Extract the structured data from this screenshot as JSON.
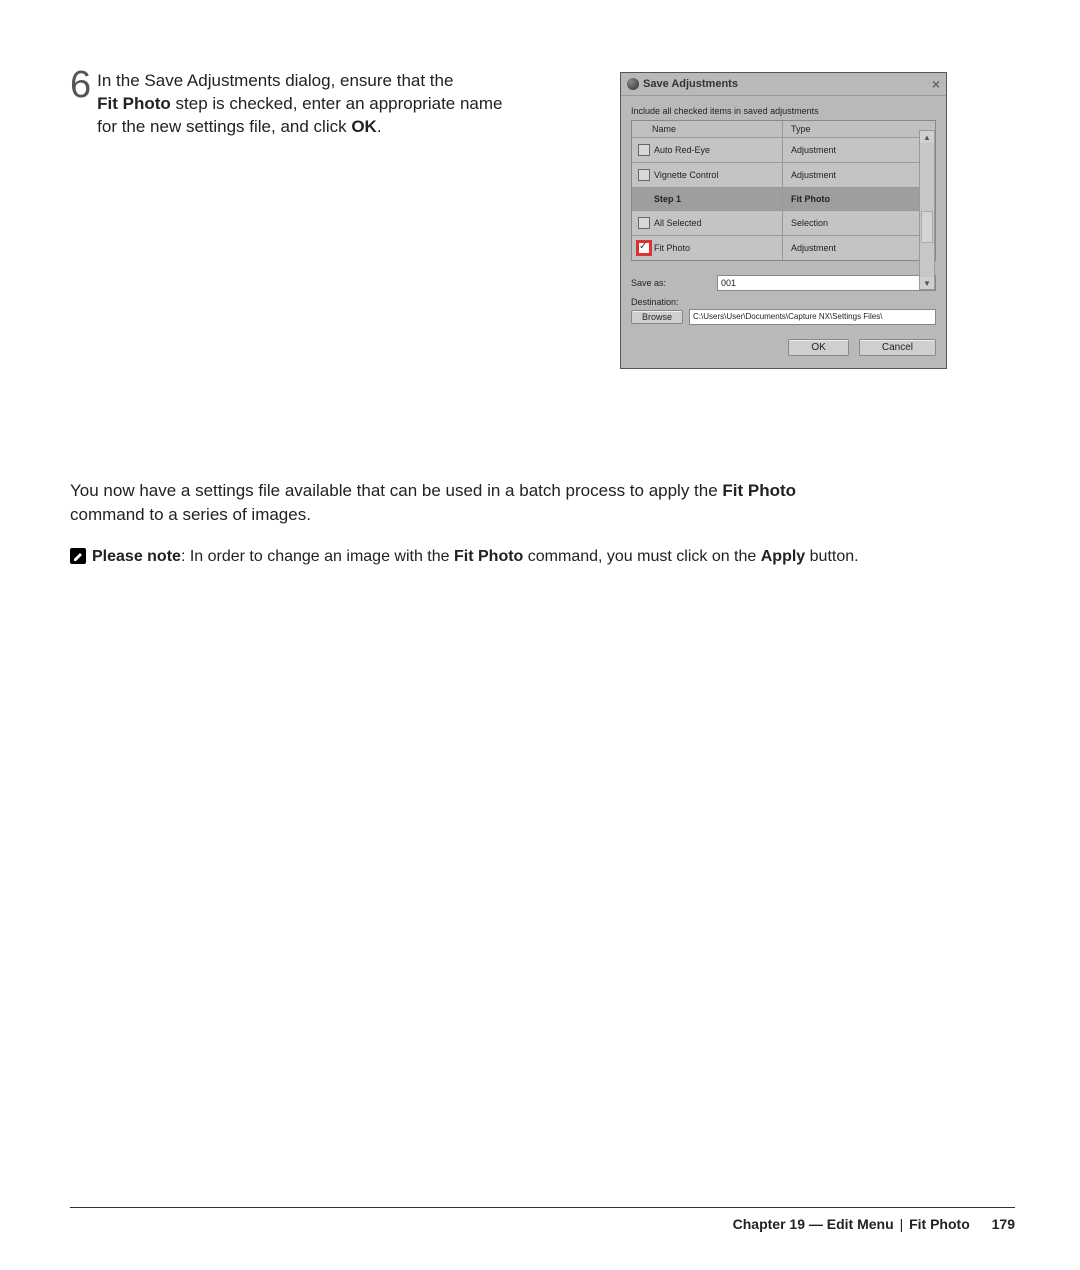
{
  "step": {
    "number": "6",
    "text_pre": "In the  Save Adjustments  dialog, ensure that the ",
    "bold1": "Fit Photo",
    "text_mid": " step is checked, enter an appropriate name for the new settings file, and click ",
    "bold2": "OK",
    "text_end": "."
  },
  "dialog": {
    "title": "Save Adjustments",
    "hint": "Include all checked items in saved adjustments",
    "col_name": "Name",
    "col_type": "Type",
    "rows": [
      {
        "name": "Auto Red-Eye",
        "type": "Adjustment",
        "checked": false,
        "dark": false
      },
      {
        "name": "Vignette Control",
        "type": "Adjustment",
        "checked": false,
        "dark": false
      },
      {
        "name": "Step 1",
        "type": "Fit Photo",
        "checked": false,
        "dark": true,
        "nocb": true
      },
      {
        "name": "All Selected",
        "type": "Selection",
        "checked": false,
        "dark": false
      },
      {
        "name": "Fit Photo",
        "type": "Adjustment",
        "checked": true,
        "dark": false,
        "hl": true
      }
    ],
    "save_as_label": "Save as:",
    "save_as_value": "001",
    "destination_label": "Destination:",
    "browse_label": "Browse",
    "destination_value": "C:\\Users\\User\\Documents\\Capture NX\\Settings Files\\",
    "ok_label": "OK",
    "cancel_label": "Cancel"
  },
  "paragraph": {
    "pre": "You now have a settings file available that can be used in a batch process to apply the ",
    "bold": "Fit Photo",
    "post": " command to a series of images."
  },
  "note": {
    "lead": "Please note",
    "t1": ": In order to change an image with the ",
    "b1": "Fit Photo",
    "t2": " command, you must click on the ",
    "b2": "Apply",
    "t3": " button."
  },
  "footer": {
    "chapter": "Chapter 19 — Edit Menu",
    "sep": "|",
    "section": "Fit Photo",
    "page": "179"
  }
}
